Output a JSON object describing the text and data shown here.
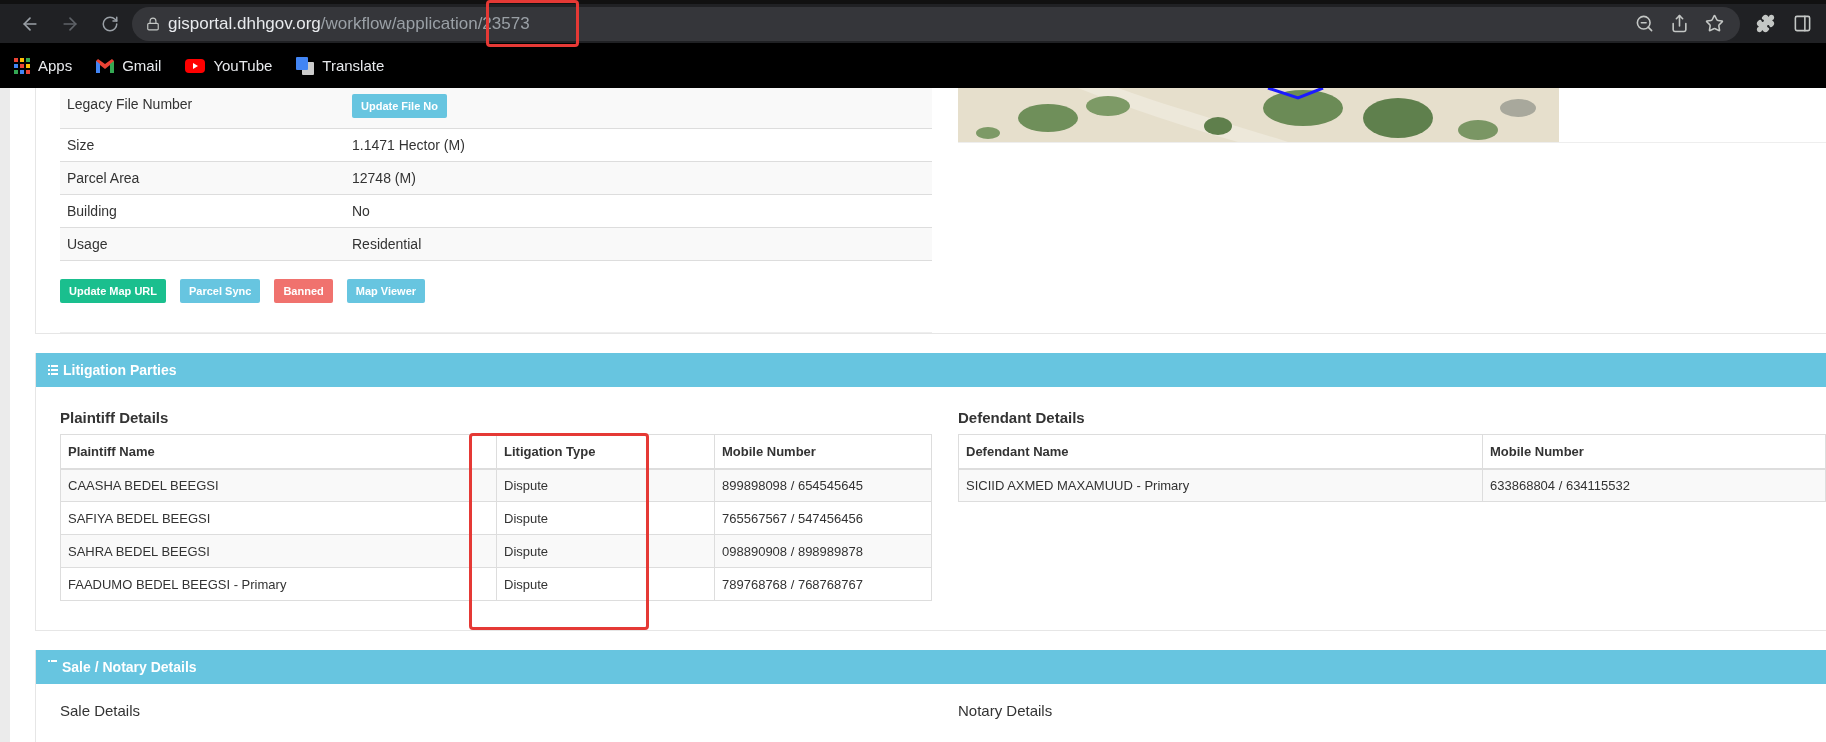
{
  "browser": {
    "url_host": "gisportal.dhhgov.org",
    "url_path": "/workflow/application/23573",
    "back_disabled": false,
    "forward_disabled": true,
    "bookmarks": [
      {
        "kind": "apps",
        "label": "Apps"
      },
      {
        "kind": "gmail",
        "label": "Gmail"
      },
      {
        "kind": "youtube",
        "label": "YouTube"
      },
      {
        "kind": "translate",
        "label": "Translate"
      }
    ]
  },
  "property": {
    "rows": [
      {
        "kind": "button",
        "label": "Legacy File Number",
        "button": "Update File No"
      },
      {
        "kind": "text",
        "label": "Size",
        "value": "1.1471 Hector (M)"
      },
      {
        "kind": "text",
        "label": "Parcel Area",
        "value": "12748 (M)"
      },
      {
        "kind": "text",
        "label": "Building",
        "value": "No"
      },
      {
        "kind": "text",
        "label": "Usage",
        "value": "Residential"
      }
    ],
    "actions": [
      {
        "label": "Update Map URL",
        "color": "#1abf8e"
      },
      {
        "label": "Parcel Sync",
        "color": "#67c5e0"
      },
      {
        "label": "Banned",
        "color": "#f0726e"
      },
      {
        "label": "Map Viewer",
        "color": "#67c5e0"
      }
    ]
  },
  "litigation": {
    "title": "Litigation Parties",
    "plaintiff": {
      "title": "Plaintiff Details",
      "columns": [
        "Plaintiff Name",
        "Litigation Type",
        "Mobile Number"
      ],
      "rows": [
        {
          "name": "CAASHA BEDEL BEEGSI",
          "type": "Dispute",
          "mobile": "899898098 / 654545645"
        },
        {
          "name": "SAFIYA BEDEL BEEGSI",
          "type": "Dispute",
          "mobile": "765567567 / 547456456"
        },
        {
          "name": "SAHRA BEDEL BEEGSI",
          "type": "Dispute",
          "mobile": "098890908 / 898989878"
        },
        {
          "name": "FAADUMO BEDEL BEEGSI - Primary",
          "type": "Dispute",
          "mobile": "789768768 / 768768767"
        }
      ]
    },
    "defendant": {
      "title": "Defendant Details",
      "columns": [
        "Defendant Name",
        "Mobile Number"
      ],
      "rows": [
        {
          "name": "SICIID AXMED MAXAMUUD - Primary",
          "mobile": "633868804 / 634115532"
        }
      ]
    }
  },
  "sale": {
    "title": "Sale / Notary Details",
    "sections": [
      "Sale Details",
      "Notary Details"
    ]
  }
}
